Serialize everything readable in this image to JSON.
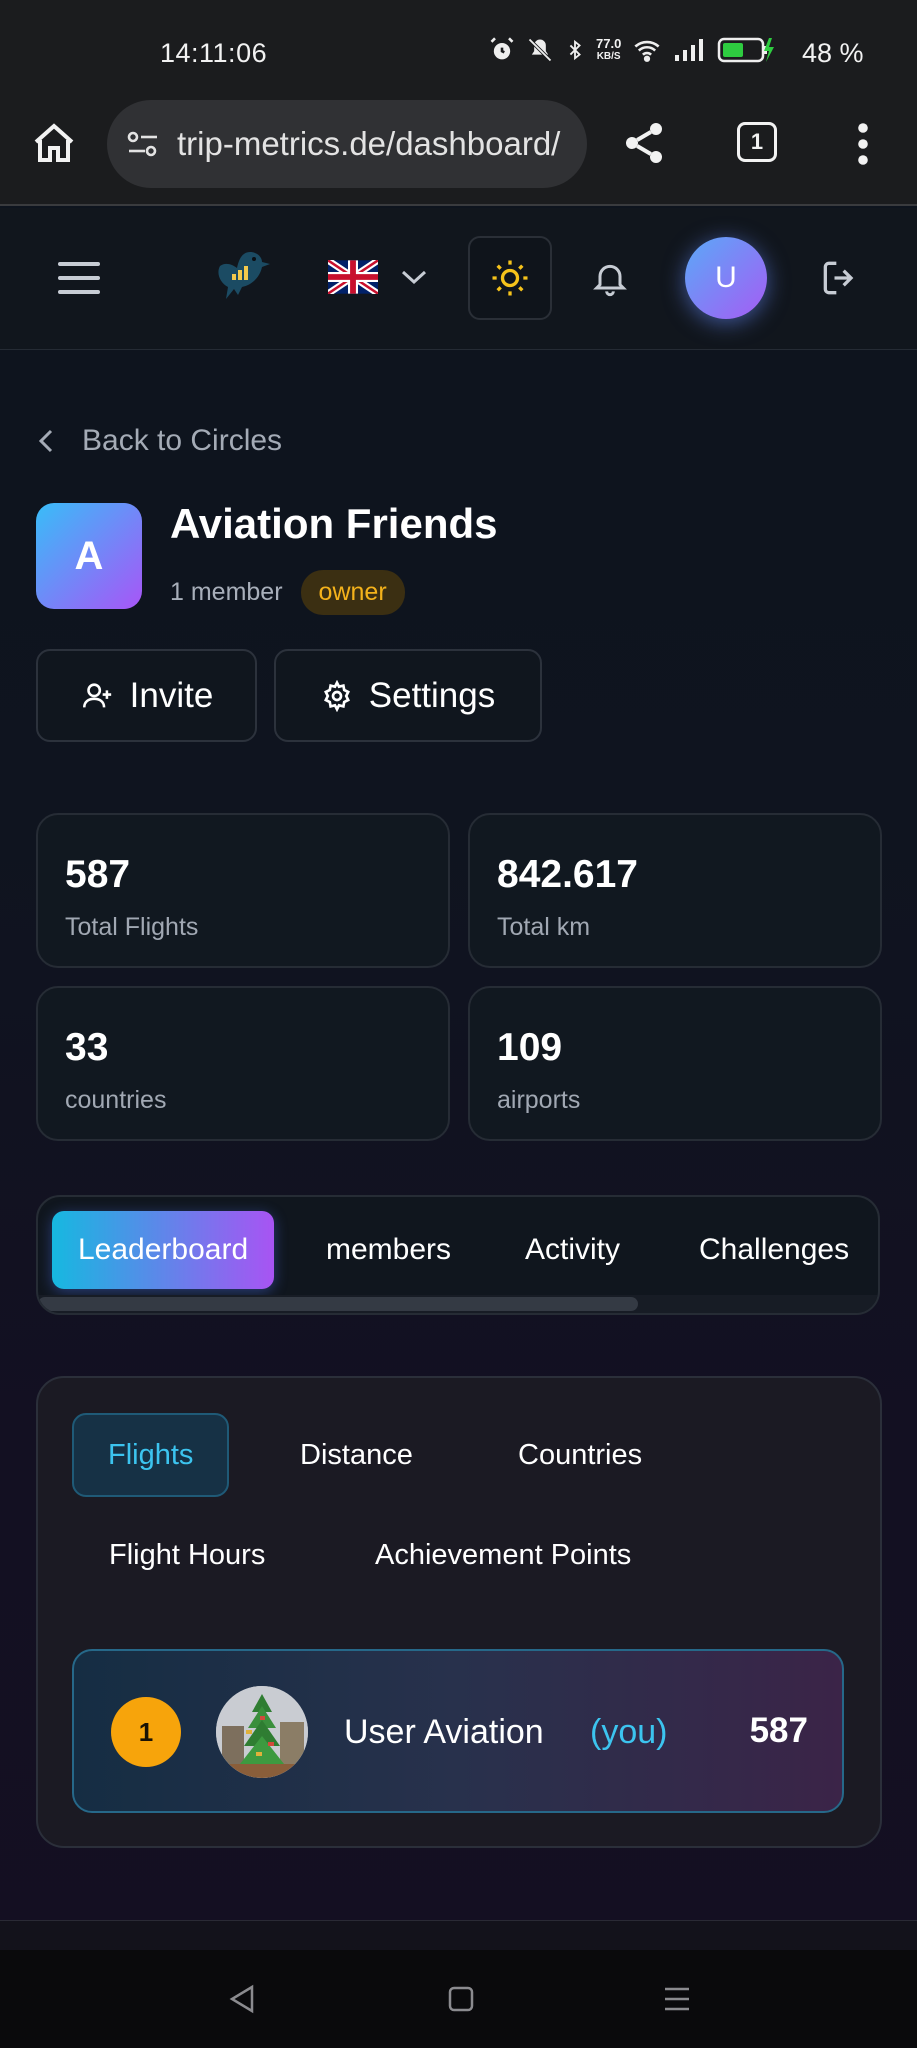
{
  "status_bar": {
    "time": "14:11:06",
    "speed_value": "77.0",
    "speed_unit": "KB/S",
    "battery": "48 %"
  },
  "browser": {
    "url": "trip-metrics.de/dashboard/",
    "tab_count": "1"
  },
  "header": {
    "language_flag": "uk-flag-icon",
    "user_initial": "U"
  },
  "circle": {
    "back_label": "Back to Circles",
    "avatar_letter": "A",
    "title": "Aviation Friends",
    "members": "1 member",
    "role_badge": "owner",
    "invite_label": "Invite",
    "settings_label": "Settings"
  },
  "stats": [
    {
      "value": "587",
      "label": "Total Flights"
    },
    {
      "value": "842.617",
      "label": "Total km"
    },
    {
      "value": "33",
      "label": "countries"
    },
    {
      "value": "109",
      "label": "airports"
    }
  ],
  "tabs": [
    {
      "label": "Leaderboard",
      "active": true
    },
    {
      "label": "members",
      "active": false
    },
    {
      "label": "Activity",
      "active": false
    },
    {
      "label": "Challenges",
      "active": false
    }
  ],
  "leaderboard": {
    "metrics": [
      "Flights",
      "Distance",
      "Countries",
      "Flight Hours",
      "Achievement Points"
    ],
    "active_metric": "Flights",
    "rows": [
      {
        "rank": "1",
        "name": "User Aviation",
        "you_tag": "(you)",
        "score": "587"
      }
    ]
  },
  "colors": {
    "accent_cyan": "#3cc4ef",
    "accent_purple": "#a854f3",
    "owner_badge": "#f4b21b",
    "rank_gold": "#f7a40b"
  }
}
